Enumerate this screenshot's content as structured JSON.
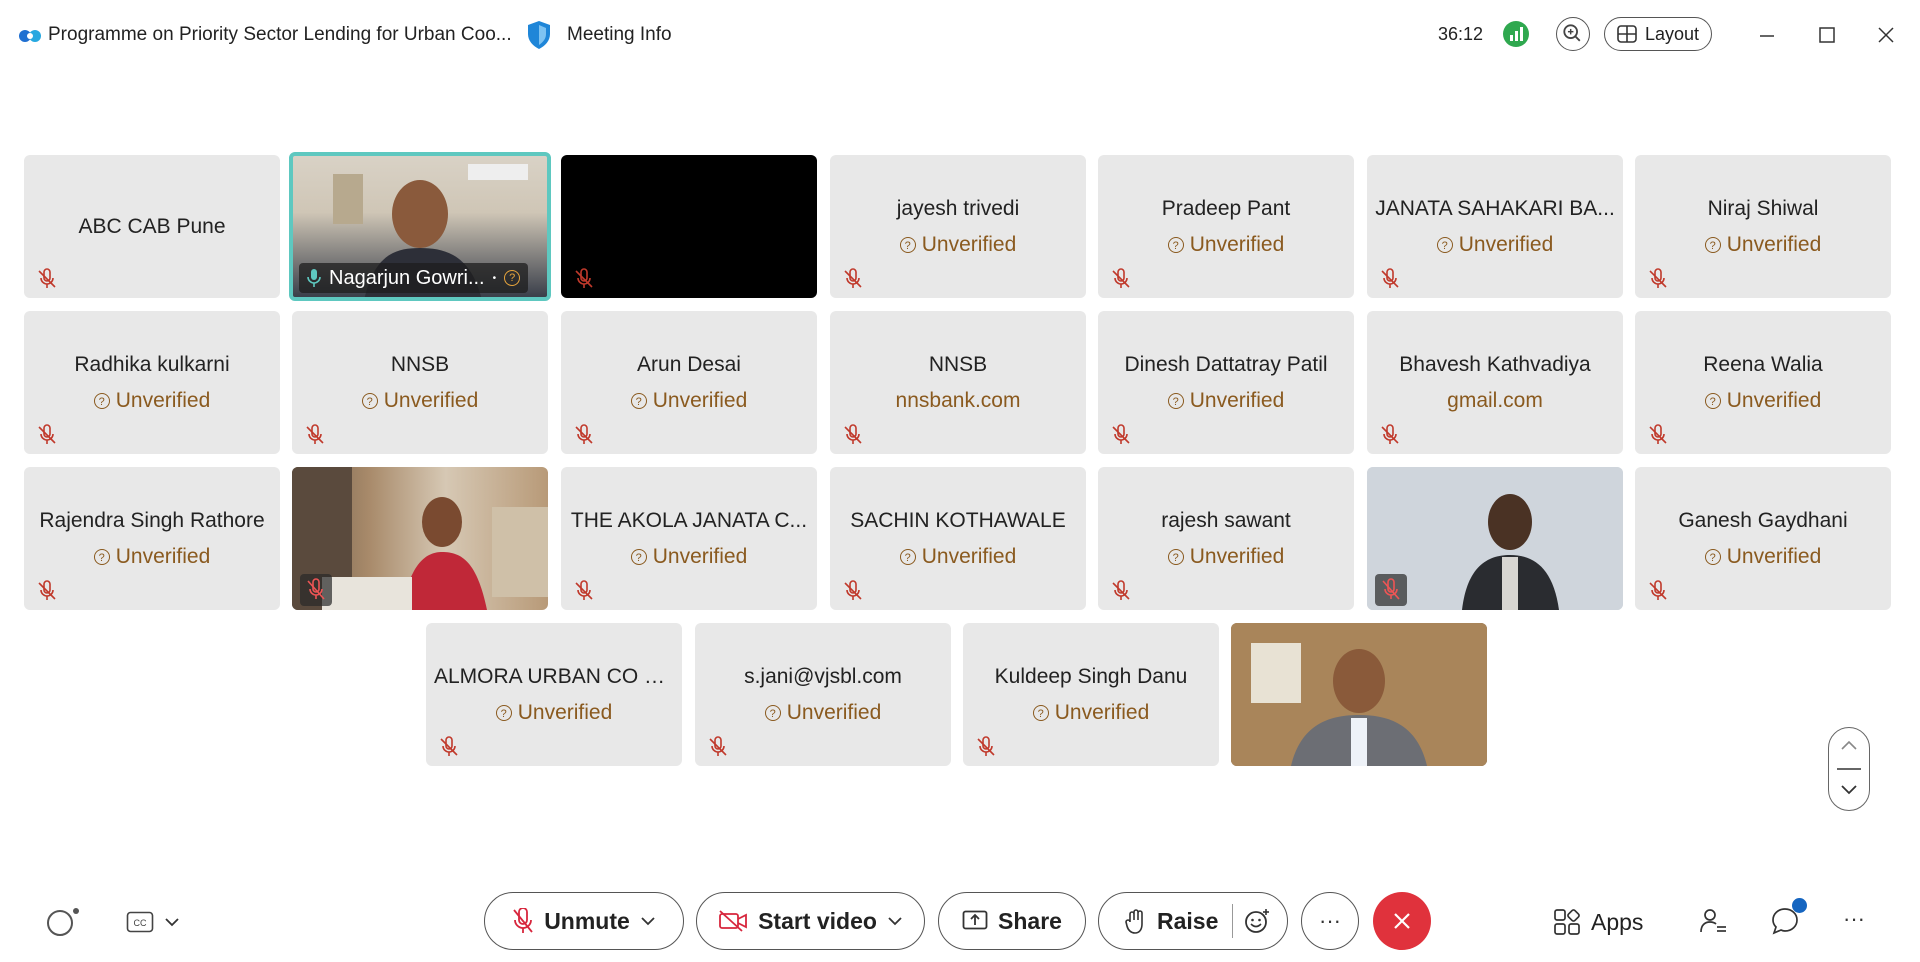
{
  "window": {
    "title": "Programme on Priority Sector Lending for Urban Coo...",
    "meeting_info": "Meeting Info",
    "timer": "36:12",
    "layout_label": "Layout"
  },
  "participants": [
    {
      "name": "ABC CAB Pune",
      "sub": ""
    },
    {
      "name": "Nagarjun Gowri...",
      "sub": ""
    },
    {
      "name": "",
      "sub": ""
    },
    {
      "name": "jayesh trivedi",
      "sub": "Unverified"
    },
    {
      "name": "Pradeep Pant",
      "sub": "Unverified"
    },
    {
      "name": "JANATA SAHAKARI BA...",
      "sub": "Unverified"
    },
    {
      "name": "Niraj Shiwal",
      "sub": "Unverified"
    },
    {
      "name": "Radhika kulkarni",
      "sub": "Unverified"
    },
    {
      "name": "NNSB",
      "sub": "Unverified"
    },
    {
      "name": "Arun Desai",
      "sub": "Unverified"
    },
    {
      "name": "NNSB",
      "sub": "nnsbank.com"
    },
    {
      "name": "Dinesh Dattatray Patil",
      "sub": "Unverified"
    },
    {
      "name": "Bhavesh Kathvadiya",
      "sub": "gmail.com"
    },
    {
      "name": "Reena Walia",
      "sub": "Unverified"
    },
    {
      "name": "Rajendra Singh Rathore",
      "sub": "Unverified"
    },
    {
      "name": "",
      "sub": ""
    },
    {
      "name": "THE AKOLA JANATA C...",
      "sub": "Unverified"
    },
    {
      "name": "SACHIN KOTHAWALE",
      "sub": "Unverified"
    },
    {
      "name": "rajesh sawant",
      "sub": "Unverified"
    },
    {
      "name": "",
      "sub": ""
    },
    {
      "name": "Ganesh Gaydhani",
      "sub": "Unverified"
    },
    {
      "name": "ALMORA URBAN CO O...",
      "sub": "Unverified"
    },
    {
      "name": "s.jani@vjsbl.com",
      "sub": "Unverified"
    },
    {
      "name": "Kuldeep Singh Danu",
      "sub": "Unverified"
    },
    {
      "name": "",
      "sub": ""
    }
  ],
  "toolbar": {
    "unmute_label": "Unmute",
    "start_video_label": "Start video",
    "share_label": "Share",
    "raise_label": "Raise",
    "more_label": "···",
    "apps_label": "Apps",
    "overflow_label": "···"
  },
  "colors": {
    "accent_active_speaker": "#5ec8c0",
    "end_call": "#e0323c",
    "unverified_text": "#8a5a1f",
    "signal": "#2fa84f"
  }
}
